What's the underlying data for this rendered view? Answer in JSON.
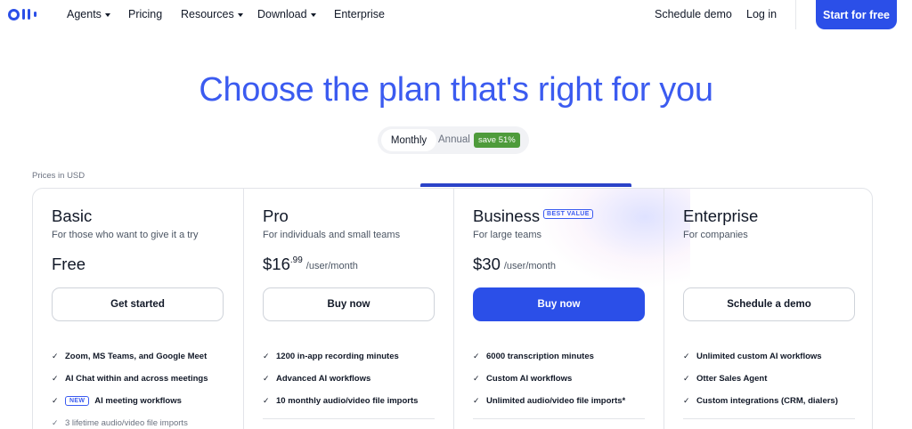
{
  "nav": {
    "logo_icon": "otter-logo-icon",
    "items": [
      {
        "label": "Agents",
        "has_caret": true
      },
      {
        "label": "Pricing",
        "has_caret": false
      },
      {
        "label": "Resources",
        "has_caret": true
      },
      {
        "label": "Download",
        "has_caret": true
      },
      {
        "label": "Enterprise",
        "has_caret": false
      }
    ],
    "schedule_demo": "Schedule demo",
    "login": "Log in",
    "cta": "Start for free"
  },
  "hero": {
    "headline": "Choose the plan that's right for you",
    "billing_toggle": {
      "monthly": "Monthly",
      "annual": "Annual",
      "save_badge": "save 51%",
      "selected": "Monthly"
    },
    "prices_note": "Prices in USD"
  },
  "colors": {
    "accent": "#2b4fe8",
    "headline": "#3b5bf0",
    "save_badge": "#4e9b3b"
  },
  "plans": [
    {
      "name": "Basic",
      "subtitle": "For those who want to give it a try",
      "price_main": "Free",
      "price_cents": "",
      "price_per": "",
      "button": "Get started",
      "features": [
        {
          "text": "Zoom, MS Teams, and Google Meet"
        },
        {
          "text": "AI Chat within and across meetings"
        },
        {
          "text": "AI meeting workflows",
          "badge": "NEW"
        },
        {
          "text": "3 lifetime audio/video file imports"
        }
      ]
    },
    {
      "name": "Pro",
      "subtitle": "For individuals and small teams",
      "price_main": "$16",
      "price_cents": ".99",
      "price_per": "/user/month",
      "button": "Buy now",
      "features": [
        {
          "text": "1200 in-app recording minutes"
        },
        {
          "text": "Advanced AI workflows"
        },
        {
          "text": "10 monthly audio/video file imports"
        }
      ]
    },
    {
      "name": "Business",
      "badge": "BEST VALUE",
      "subtitle": "For large teams",
      "price_main": "$30",
      "price_cents": "",
      "price_per": "/user/month",
      "button": "Buy now",
      "features": [
        {
          "text": "6000 transcription minutes"
        },
        {
          "text": "Custom AI workflows"
        },
        {
          "text": "Unlimited audio/video file imports*"
        }
      ]
    },
    {
      "name": "Enterprise",
      "subtitle": "For companies",
      "price_main": "",
      "price_cents": "",
      "price_per": "",
      "button": "Schedule a demo",
      "features": [
        {
          "text": "Unlimited custom AI workflows"
        },
        {
          "text": "Otter Sales Agent"
        },
        {
          "text": "Custom integrations (CRM, dialers)"
        }
      ]
    }
  ]
}
